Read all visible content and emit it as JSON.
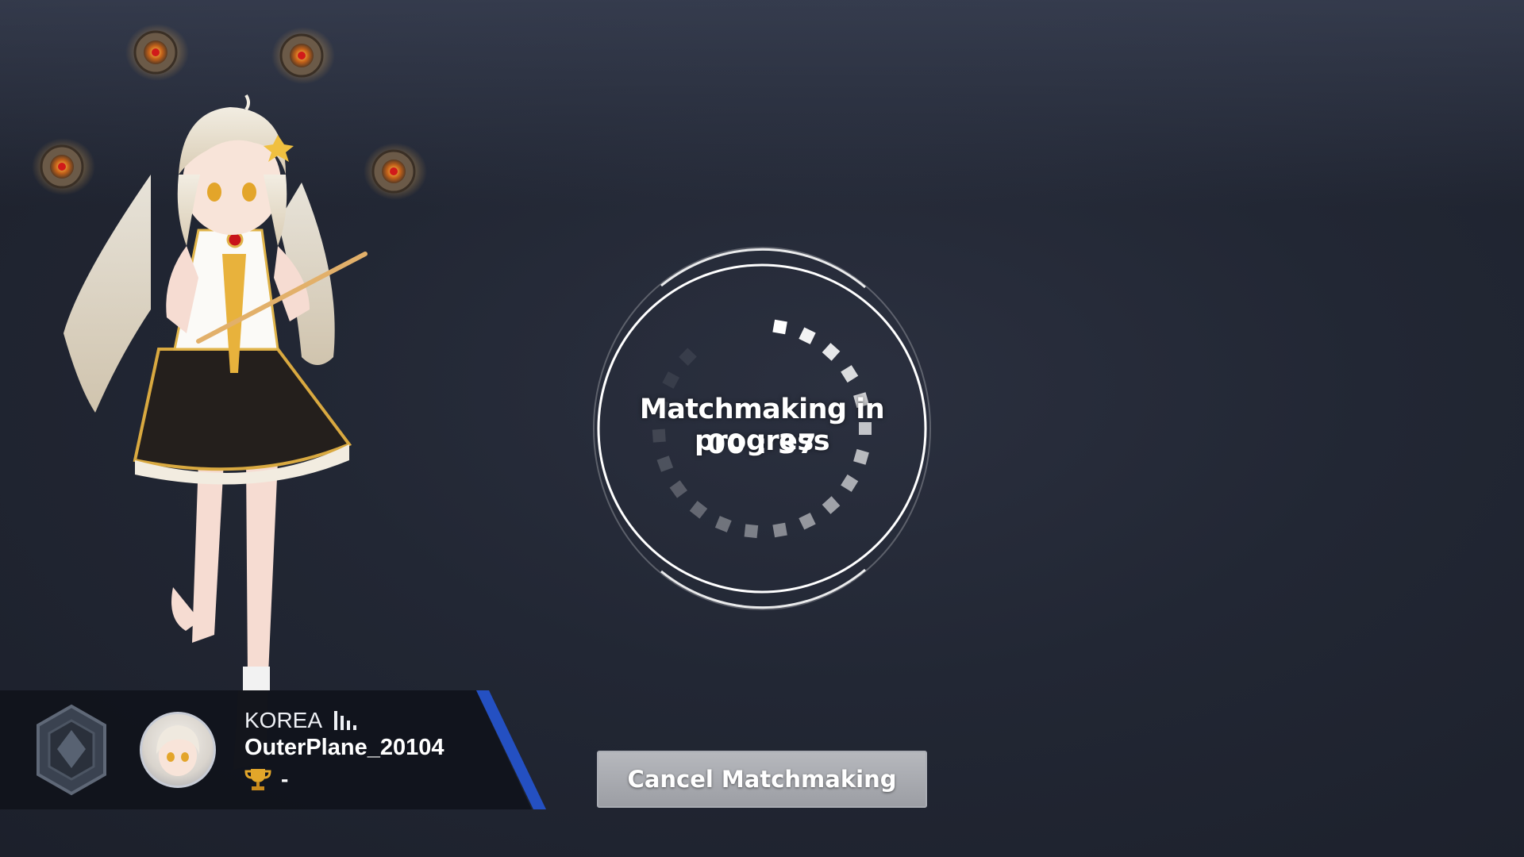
{
  "matchmaking": {
    "status_text": "Matchmaking in progress",
    "timer": "00 : 37",
    "cancel_label": "Cancel Matchmaking"
  },
  "player": {
    "server": "KOREA",
    "name": "OuterPlane_20104",
    "trophy_value": "-",
    "icons": {
      "rank": "rank-emblem-icon",
      "signal": "signal-strength-icon",
      "trophy": "trophy-icon"
    }
  },
  "colors": {
    "background": "#222734",
    "panel_background": "#11141c",
    "panel_accent": "#2450c2",
    "button_fill": "#a8aab0",
    "ring": "#ffffff"
  }
}
